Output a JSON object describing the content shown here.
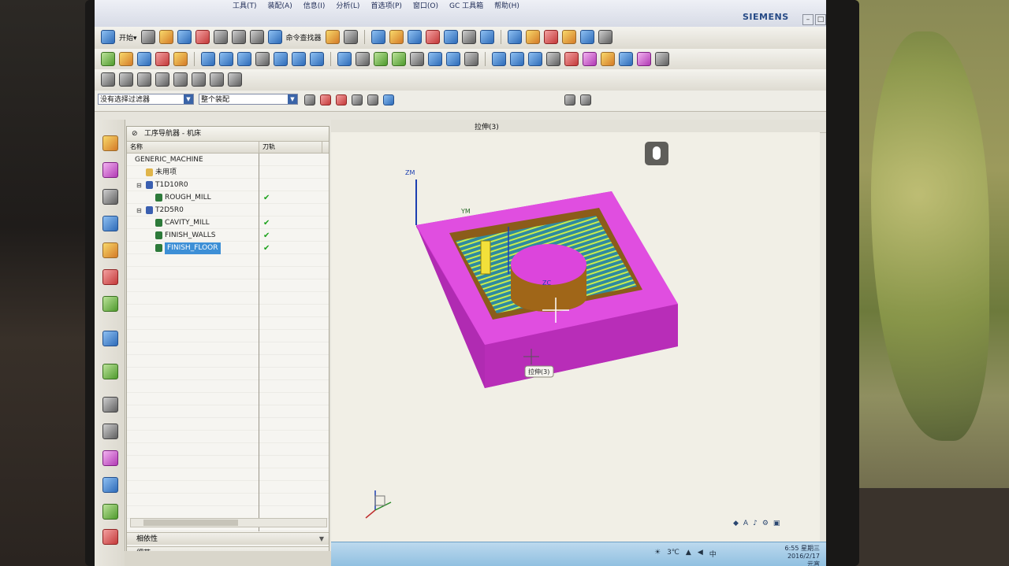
{
  "window": {
    "brand": "SIEMENS",
    "menu": [
      "工具(T)",
      "装配(A)",
      "信息(I)",
      "分析(L)",
      "首选项(P)",
      "窗口(O)",
      "GC 工具箱",
      "帮助(H)"
    ],
    "controls": {
      "minimize": "–",
      "restore": "□",
      "close": "×"
    }
  },
  "toolbar": {
    "start_label": "开始▾",
    "command_finder_label": "命令查找器"
  },
  "filters": {
    "selection_filter": "没有选择过滤器",
    "assembly_scope": "整个装配"
  },
  "drawing_title": "拉伸(3)",
  "navigator": {
    "title": "工序导航器 - 机床",
    "columns": {
      "name": "名称",
      "path": "刀轨"
    },
    "rows": [
      {
        "label": "GENERIC_MACHINE",
        "indent": 0,
        "toggle": "",
        "check": "",
        "icon": "none",
        "selected": false
      },
      {
        "label": "未用项",
        "indent": 1,
        "toggle": "",
        "check": "",
        "icon": "folder",
        "selected": false
      },
      {
        "label": "T1D10R0",
        "indent": 1,
        "toggle": "⊟",
        "check": "",
        "icon": "tool",
        "selected": false
      },
      {
        "label": "ROUGH_MILL",
        "indent": 2,
        "toggle": "",
        "check": "✔",
        "icon": "op",
        "selected": false
      },
      {
        "label": "T2D5R0",
        "indent": 1,
        "toggle": "⊟",
        "check": "",
        "icon": "tool",
        "selected": false
      },
      {
        "label": "CAVITY_MILL",
        "indent": 2,
        "toggle": "",
        "check": "✔",
        "icon": "op",
        "selected": false
      },
      {
        "label": "FINISH_WALLS",
        "indent": 2,
        "toggle": "",
        "check": "✔",
        "icon": "op",
        "selected": false
      },
      {
        "label": "FINISH_FLOOR",
        "indent": 2,
        "toggle": "",
        "check": "✔",
        "icon": "op",
        "selected": true
      }
    ],
    "panels": [
      "相依性",
      "细节"
    ]
  },
  "viewport": {
    "axis_zm": "ZM",
    "axis_ym": "YM",
    "axis_xm": "XM",
    "axis_zc": "ZC",
    "tooltip": "拉伸(3)"
  },
  "taskbar": {
    "temperature": "3℃",
    "time": "6:55 星期三",
    "date": "2016/2/17",
    "ime": "中",
    "unit": "元宵"
  },
  "colors": {
    "part_magenta": "#d437d6",
    "cavity_brown": "#9a6a1e",
    "toolpath_green": "#b6e34a",
    "selection_blue": "#3d8fd6"
  }
}
